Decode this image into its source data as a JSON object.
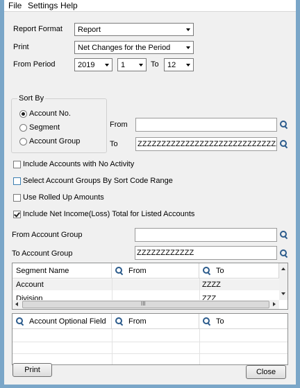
{
  "menu": {
    "file": "File",
    "settings": "Settings",
    "help": "Help"
  },
  "report_format": {
    "label": "Report Format",
    "value": "Report"
  },
  "print": {
    "label": "Print",
    "value": "Net Changes for the Period"
  },
  "from_period": {
    "label": "From Period",
    "year": "2019",
    "from": "1",
    "to_label": "To",
    "to": "12"
  },
  "sort_by": {
    "title": "Sort By",
    "options": [
      {
        "label": "Account No.",
        "selected": true
      },
      {
        "label": "Segment",
        "selected": false
      },
      {
        "label": "Account Group",
        "selected": false
      }
    ],
    "from_label": "From",
    "from_value": "",
    "to_label": "To",
    "to_value": "ZZZZZZZZZZZZZZZZZZZZZZZZZZZZZZZZZZZZZZZZZZ"
  },
  "checkboxes": [
    {
      "label": "Include Accounts with No Activity",
      "checked": false
    },
    {
      "label": "Select Account Groups By Sort Code Range",
      "checked": false
    },
    {
      "label": "Use Rolled Up Amounts",
      "checked": false
    },
    {
      "label": "Include Net Income(Loss) Total for Listed Accounts",
      "checked": true
    }
  ],
  "account_group": {
    "from_label": "From Account Group",
    "from_value": "",
    "to_label": "To Account Group",
    "to_value": "ZZZZZZZZZZZZ"
  },
  "segment_grid": {
    "headers": {
      "name": "Segment Name",
      "from": "From",
      "to": "To"
    },
    "rows": [
      {
        "name": "Account",
        "from": "",
        "to": "ZZZZ"
      },
      {
        "name": "Division",
        "from": "",
        "to": "ZZZ"
      }
    ],
    "hscroll_grip": "III"
  },
  "optional_grid": {
    "headers": {
      "field": "Account Optional Field",
      "from": "From",
      "to": "To"
    }
  },
  "buttons": {
    "print": "Print",
    "close": "Close"
  },
  "colors": {
    "window_frame": "#7aa6c8",
    "dialog_bg": "#f0f0f0",
    "finder_icon": "#2b5b8c"
  }
}
